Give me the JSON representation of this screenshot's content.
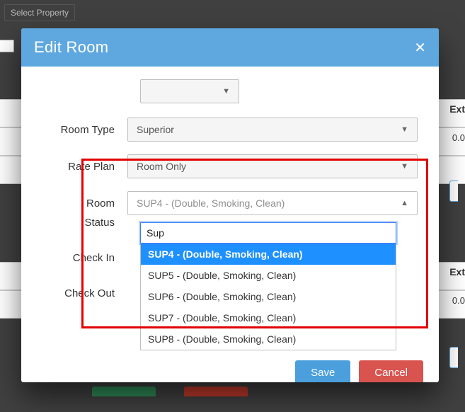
{
  "backdrop": {
    "select_property": "Select Property",
    "ext_label": "Ext",
    "ext_value": "0.0"
  },
  "modal": {
    "title": "Edit Room",
    "room_type_label": "Room Type",
    "room_type_value": "Superior",
    "rate_plan_label": "Rate Plan",
    "rate_plan_value": "Room Only",
    "room_label": "Room",
    "room_value": "SUP4 - (Double, Smoking, Clean)",
    "status_label": "Status",
    "checkin_label": "Check In",
    "checkout_label": "Check Out",
    "search_value": "Sup",
    "options": [
      "SUP4 - (Double, Smoking, Clean)",
      "SUP5 - (Double, Smoking, Clean)",
      "SUP6 - (Double, Smoking, Clean)",
      "SUP7 - (Double, Smoking, Clean)",
      "SUP8 - (Double, Smoking, Clean)"
    ],
    "save": "Save",
    "cancel": "Cancel"
  },
  "caret_down": "▼",
  "caret_up": "▲"
}
